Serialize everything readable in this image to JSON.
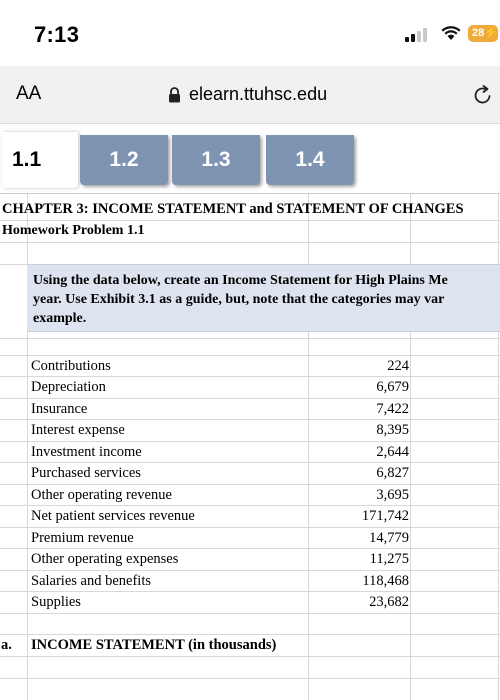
{
  "status_bar": {
    "time": "7:13",
    "battery": "28",
    "battery_color": "#f0a93b"
  },
  "browser": {
    "text_size_label": "AA",
    "url": "elearn.ttuhsc.edu"
  },
  "tabs": [
    {
      "label": "1.1",
      "active": true
    },
    {
      "label": "1.2",
      "active": false
    },
    {
      "label": "1.3",
      "active": false
    },
    {
      "label": "1.4",
      "active": false
    }
  ],
  "sheet": {
    "chapter_title": "CHAPTER 3: INCOME STATEMENT and STATEMENT OF CHANGES",
    "problem_title": "Homework Problem 1.1",
    "instructions": [
      "Using the data below, create an Income Statement for High Plains Me",
      "year.  Use Exhibit 3.1 as a guide, but, note that the categories may var",
      "example."
    ],
    "items": [
      {
        "label": "Contributions",
        "value": "224"
      },
      {
        "label": "Depreciation",
        "value": "6,679"
      },
      {
        "label": "Insurance",
        "value": "7,422"
      },
      {
        "label": "Interest expense",
        "value": "8,395"
      },
      {
        "label": "Investment income",
        "value": "2,644"
      },
      {
        "label": "Purchased services",
        "value": "6,827"
      },
      {
        "label": "Other operating revenue",
        "value": "3,695"
      },
      {
        "label": "Net patient services revenue",
        "value": "171,742"
      },
      {
        "label": "Premium revenue",
        "value": "14,779"
      },
      {
        "label": "Other operating expenses",
        "value": "11,275"
      },
      {
        "label": "Salaries and benefits",
        "value": "118,468"
      },
      {
        "label": "Supplies",
        "value": "23,682"
      }
    ],
    "part_label": "a.",
    "income_statement_heading": "INCOME STATEMENT (in thousands)"
  }
}
